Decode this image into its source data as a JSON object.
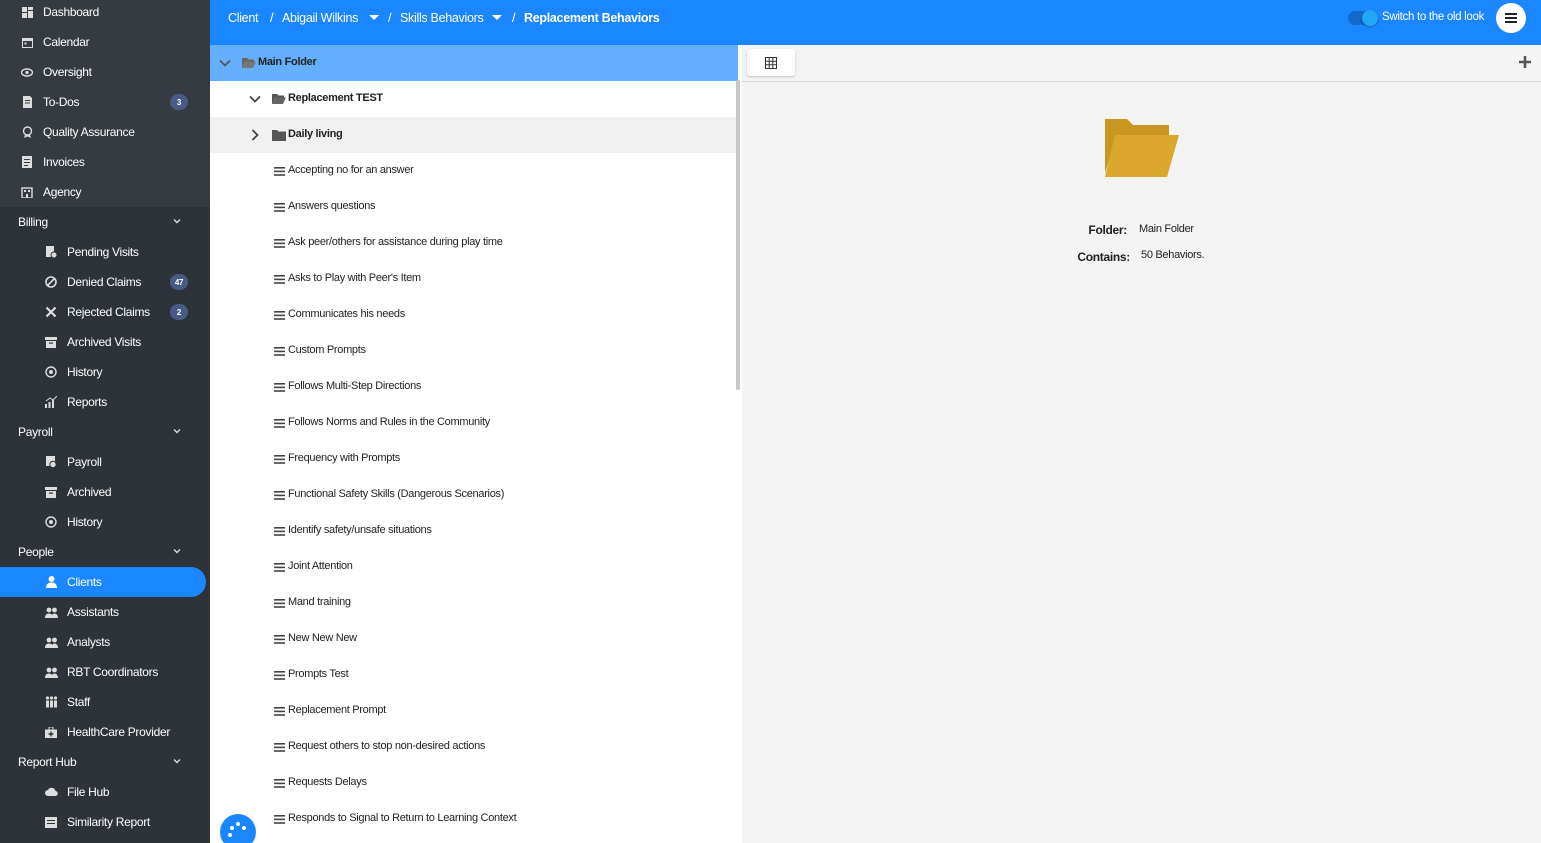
{
  "sidebar": {
    "items": [
      {
        "label": "Dashboard",
        "icon": "dashboard-icon"
      },
      {
        "label": "Calendar",
        "icon": "calendar-icon"
      },
      {
        "label": "Oversight",
        "icon": "eye-icon"
      },
      {
        "label": "To-Dos",
        "icon": "todo-icon",
        "badge": "3"
      },
      {
        "label": "Quality Assurance",
        "icon": "qa-icon"
      },
      {
        "label": "Invoices",
        "icon": "invoice-icon"
      },
      {
        "label": "Agency",
        "icon": "agency-icon"
      }
    ],
    "billing": {
      "label": "Billing",
      "items": [
        {
          "label": "Pending Visits",
          "icon": "pending-icon"
        },
        {
          "label": "Denied Claims",
          "icon": "denied-icon",
          "badge": "47"
        },
        {
          "label": "Rejected Claims",
          "icon": "close-icon",
          "badge": "2"
        },
        {
          "label": "Archived Visits",
          "icon": "archive-icon"
        },
        {
          "label": "History",
          "icon": "history-icon"
        },
        {
          "label": "Reports",
          "icon": "reports-icon"
        }
      ]
    },
    "payroll": {
      "label": "Payroll",
      "items": [
        {
          "label": "Payroll",
          "icon": "payroll-icon"
        },
        {
          "label": "Archived",
          "icon": "archive-icon"
        },
        {
          "label": "History",
          "icon": "history-icon"
        }
      ]
    },
    "people": {
      "label": "People",
      "items": [
        {
          "label": "Clients",
          "icon": "user-icon"
        },
        {
          "label": "Assistants",
          "icon": "users-icon"
        },
        {
          "label": "Analysts",
          "icon": "users-icon"
        },
        {
          "label": "RBT Coordinators",
          "icon": "users-icon"
        },
        {
          "label": "Staff",
          "icon": "staff-icon"
        },
        {
          "label": "HealthCare Provider",
          "icon": "medkit-icon"
        }
      ]
    },
    "report_hub": {
      "label": "Report Hub",
      "items": [
        {
          "label": "File Hub",
          "icon": "cloud-icon"
        },
        {
          "label": "Similarity Report",
          "icon": "report-icon"
        }
      ]
    }
  },
  "header": {
    "breadcrumb": [
      "Client",
      "Abigail Wilkins",
      "Skills Behaviors",
      "Replacement Behaviors"
    ],
    "switch_label": "Switch to the old look"
  },
  "tree": {
    "root": "Main Folder",
    "folders": [
      "Replacement TEST",
      "Daily living"
    ],
    "behaviors": [
      "Accepting no for an answer",
      "Answers questions",
      "Ask peer/others for assistance during play time",
      "Asks to Play with Peer's Item",
      "Communicates his needs",
      "Custom Prompts",
      "Follows Multi-Step Directions",
      "Follows Norms and Rules in the Community",
      "Frequency with Prompts",
      "Functional Safety Skills (Dangerous Scenarios)",
      "Identify safety/unsafe situations",
      "Joint Attention",
      "Mand training",
      "New New New",
      "Prompts Test",
      "Replacement Prompt",
      "Request others to stop non-desired actions",
      "Requests Delays",
      "Responds to Signal to Return to Learning Context"
    ]
  },
  "detail": {
    "folder_label": "Folder:",
    "folder_value": "Main Folder",
    "contains_label": "Contains:",
    "contains_value": "50 Behaviors."
  },
  "colors": {
    "accent": "#1a86ff",
    "sidebar": "#2d3338",
    "folder": "#dba72d",
    "selected_row": "#64b0ff"
  }
}
